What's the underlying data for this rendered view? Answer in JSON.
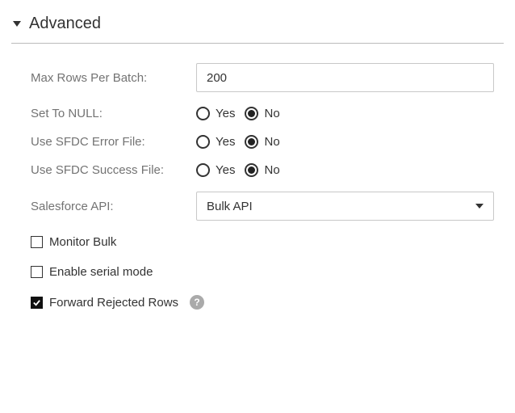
{
  "section": {
    "title": "Advanced"
  },
  "fields": {
    "maxRows": {
      "label": "Max Rows Per Batch:",
      "value": "200"
    },
    "setNull": {
      "label": "Set To NULL:",
      "yes": "Yes",
      "no": "No",
      "value": "No"
    },
    "errFile": {
      "label": "Use SFDC Error File:",
      "yes": "Yes",
      "no": "No",
      "value": "No"
    },
    "succFile": {
      "label": "Use SFDC Success File:",
      "yes": "Yes",
      "no": "No",
      "value": "No"
    },
    "api": {
      "label": "Salesforce API:",
      "selected": "Bulk API"
    }
  },
  "checks": {
    "monitor": {
      "label": "Monitor Bulk",
      "checked": false
    },
    "serial": {
      "label": "Enable serial mode",
      "checked": false
    },
    "forward": {
      "label": "Forward Rejected Rows",
      "checked": true
    }
  },
  "help": {
    "symbol": "?"
  }
}
